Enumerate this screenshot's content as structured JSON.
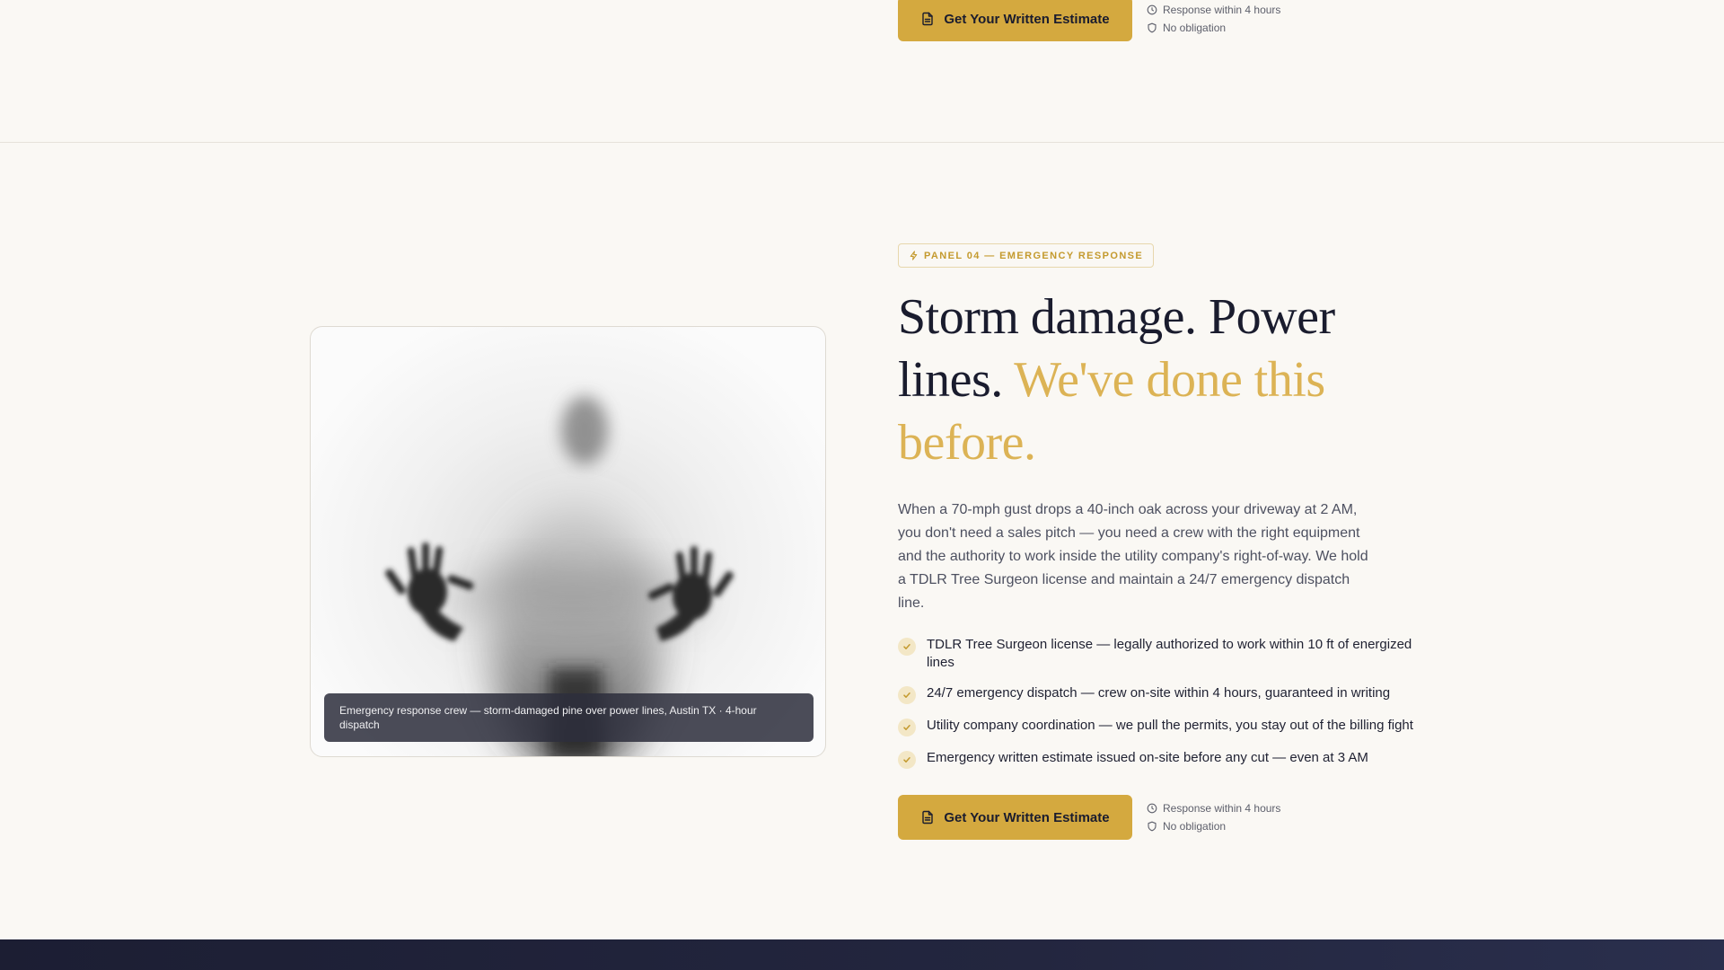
{
  "top_cta": {
    "button_label": "Get Your Written Estimate",
    "button_icon": "document-icon",
    "meta": [
      {
        "icon": "clock-icon",
        "text": "Response within 4 hours"
      },
      {
        "icon": "shield-icon",
        "text": "No obligation"
      }
    ]
  },
  "image": {
    "caption": "Emergency response crew — storm-damaged pine over power lines, Austin TX · 4-hour dispatch"
  },
  "badge": {
    "icon": "lightning-icon",
    "label": "PANEL 04 — EMERGENCY RESPONSE"
  },
  "headline": {
    "line_main": "Storm damage. Power lines.",
    "line_accent": "We've done this before."
  },
  "body": "When a 70-mph gust drops a 40-inch oak across your driveway at 2 AM, you don't need a sales pitch — you need a crew with the right equipment and the authority to work inside the utility company's right-of-way. We hold a TDLR Tree Surgeon license and maintain a 24/7 emergency dispatch line.",
  "checklist": [
    "TDLR Tree Surgeon license — legally authorized to work within 10 ft of energized lines",
    "24/7 emergency dispatch — crew on-site within 4 hours, guaranteed in writing",
    "Utility company coordination — we pull the permits, you stay out of the billing fight",
    "Emergency written estimate issued on-site before any cut — even at 3 AM"
  ],
  "bottom_cta": {
    "button_label": "Get Your Written Estimate",
    "button_icon": "document-icon",
    "meta": [
      {
        "icon": "clock-icon",
        "text": "Response within 4 hours"
      },
      {
        "icon": "shield-icon",
        "text": "No obligation"
      }
    ]
  },
  "colors": {
    "accent": "#d4a93f",
    "accent_text": "#dcb355",
    "ink": "#1a1c2e",
    "background": "#faf8f4",
    "footer_band": "#1c1e33"
  }
}
